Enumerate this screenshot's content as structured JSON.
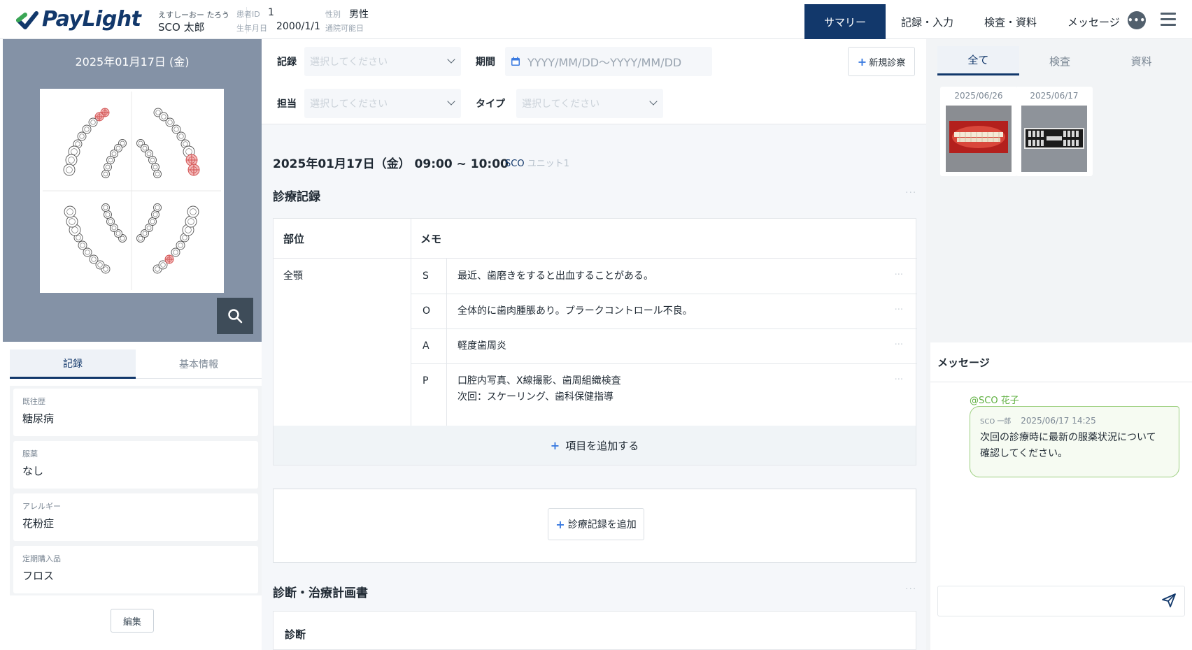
{
  "header": {
    "brand": "PayLight",
    "patient_kana": "えすしーおー たろう",
    "patient_name": "SCO 太郎",
    "id_label": "患者ID",
    "id_value": "1",
    "gender_label": "性別",
    "gender_value": "男性",
    "dob_label": "生年月日",
    "dob_value": "2000/1/1",
    "visit_label": "通院可能日",
    "nav": [
      "サマリー",
      "記録・入力",
      "検査・資料",
      "メッセージ"
    ],
    "chat_icon": "chat-bubble-icon",
    "menu_icon": "hamburger-menu-icon",
    "brand_color": "#12386b"
  },
  "left": {
    "chart_date": "2025年01月17日 (金)",
    "tabs": [
      "記録",
      "基本情報"
    ],
    "cards": [
      {
        "label": "既往歴",
        "value": "糖尿病"
      },
      {
        "label": "服薬",
        "value": "なし"
      },
      {
        "label": "アレルギー",
        "value": "花粉症"
      },
      {
        "label": "定期購入品",
        "value": "フロス"
      }
    ],
    "edit_label": "編集"
  },
  "filters": {
    "record_label": "記録",
    "record_placeholder": "選択してください",
    "period_label": "期間",
    "period_placeholder": "YYYY/MM/DD〜YYYY/MM/DD",
    "staff_label": "担当",
    "staff_placeholder": "選択してください",
    "type_label": "タイプ",
    "type_placeholder": "選択してください",
    "new_label": "新規診察"
  },
  "session": {
    "title": "2025年01月17日（金） 09:00 ~ 10:00",
    "unit_prefix": "SCO",
    "unit_name": "ユニット1"
  },
  "record": {
    "section_title": "診療記録",
    "col_part": "部位",
    "col_memo": "メモ",
    "part": "全顎",
    "rows": [
      {
        "key": "S",
        "text": "最近、歯磨きをすると出血することがある。"
      },
      {
        "key": "O",
        "text": "全体的に歯肉腫脹あり。プラークコントロール不良。"
      },
      {
        "key": "A",
        "text": "軽度歯周炎"
      },
      {
        "key": "P",
        "text": "口腔内写真、X線撮影、歯周組織検査",
        "text2": "次回：スケーリング、歯科保健指導"
      }
    ],
    "add_item": "項目を追加する",
    "add_record": "診療記録を追加",
    "more_icon": "ellipsis-icon"
  },
  "plan": {
    "section_title": "診断・治療計画書",
    "diag_label": "診断"
  },
  "right": {
    "tabs": [
      "全て",
      "検査",
      "資料"
    ],
    "thumbs": [
      {
        "date": "2025/06/26"
      },
      {
        "date": "2025/06/17"
      }
    ],
    "msg_title": "メッセージ",
    "mention": "@SCO 花子",
    "msg_sender": "SCO 一郎",
    "msg_time": "2025/06/17 14:25",
    "msg_text_1": "次回の診療時に最新の服薬状況について",
    "msg_text_2": "確認してください。",
    "input_placeholder": "",
    "send_icon": "send-icon"
  }
}
